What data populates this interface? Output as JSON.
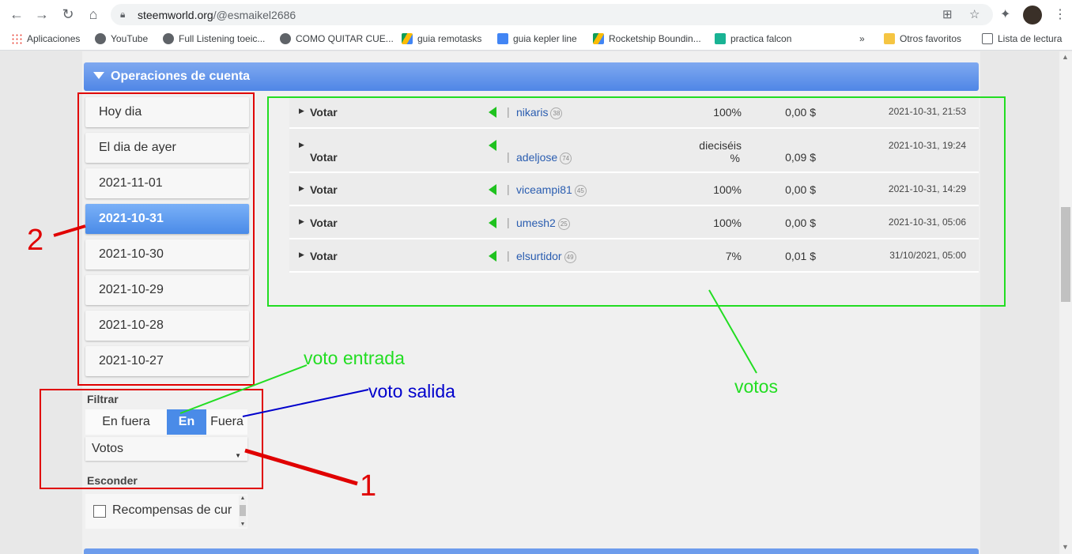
{
  "browser": {
    "url_host": "steemworld.org",
    "url_path": "/@esmaikel2686"
  },
  "bookmarks": [
    {
      "label": "Aplicaciones",
      "icon": "apps-grid-icon"
    },
    {
      "label": "YouTube",
      "icon": "globe-icon"
    },
    {
      "label": "Full Listening toeic...",
      "icon": "globe-icon"
    },
    {
      "label": "COMO QUITAR CUE...",
      "icon": "globe-icon"
    },
    {
      "label": "guia remotasks",
      "icon": "google-drive-icon"
    },
    {
      "label": "guia kepler line",
      "icon": "google-docs-icon"
    },
    {
      "label": "Rocketship Boundin...",
      "icon": "google-drive-icon"
    },
    {
      "label": "practica falcon",
      "icon": "bookmark-icon"
    },
    {
      "label": "Otros favoritos",
      "icon": "folder-icon"
    },
    {
      "label": "Lista de lectura",
      "icon": "reading-list-icon"
    }
  ],
  "section": {
    "title": "Operaciones de cuenta"
  },
  "dates": [
    "Hoy dia",
    "El dia de ayer",
    "2021-11-01",
    "2021-10-31",
    "2021-10-30",
    "2021-10-29",
    "2021-10-28",
    "2021-10-27"
  ],
  "active_date": "2021-10-31",
  "filter": {
    "label": "Filtrar",
    "options": [
      "En fuera",
      "En",
      "Fuera"
    ],
    "active": "En",
    "select_value": "Votos"
  },
  "hide": {
    "label": "Esconder",
    "checkbox_label": "Recompensas de cur"
  },
  "votes": [
    {
      "type": "Votar",
      "user": "nikaris",
      "rep": "38",
      "percent": "100%",
      "value": "0,00 $",
      "time": "2021-10-31, 21:53"
    },
    {
      "type": "Votar",
      "user": "adeljose",
      "rep": "74",
      "percent": "dieciséis %",
      "percent_line1": "dieciséis",
      "percent_line2": "%",
      "value": "0,09 $",
      "time": "2021-10-31, 19:24"
    },
    {
      "type": "Votar",
      "user": "viceampi81",
      "rep": "45",
      "percent": "100%",
      "value": "0,00 $",
      "time": "2021-10-31, 14:29"
    },
    {
      "type": "Votar",
      "user": "umesh2",
      "rep": "25",
      "percent": "100%",
      "value": "0,00 $",
      "time": "2021-10-31, 05:06"
    },
    {
      "type": "Votar",
      "user": "elsurtidor",
      "rep": "49",
      "percent": "7%",
      "value": "0,01 $",
      "time": "31/10/2021, 05:00"
    }
  ],
  "annotations": {
    "num_1": "1",
    "num_2": "2",
    "voto_entrada": "voto entrada",
    "voto_salida": "voto salida",
    "votos": "votos"
  },
  "colors": {
    "accent_blue": "#4a8be8",
    "annotation_red": "#e00000",
    "annotation_green": "#22dd22",
    "annotation_blue": "#0000cc",
    "vote_flag_green": "#1fc21f"
  }
}
